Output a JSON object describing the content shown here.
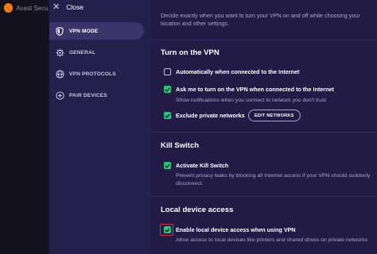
{
  "background_app": {
    "title": "Avast Secu"
  },
  "window": {
    "close_label": "Close"
  },
  "nav": {
    "items": [
      {
        "label": "VPN MODE",
        "icon": "shield-icon",
        "active": true
      },
      {
        "label": "GENERAL",
        "icon": "gear-icon",
        "active": false
      },
      {
        "label": "VPN PROTOCOLS",
        "icon": "globe-icon",
        "active": false
      },
      {
        "label": "PAIR DEVICES",
        "icon": "plus-circle-icon",
        "active": false
      }
    ]
  },
  "content": {
    "intro": "Decide exactly when you want to turn your VPN on and off while choosing your location and other settings.",
    "sections": [
      {
        "title": "Turn on the VPN",
        "options": [
          {
            "label": "Automatically when connected to the Internet",
            "checked": false,
            "description": ""
          },
          {
            "label": "Ask me to turn on the VPN when connected to the Internet",
            "checked": true,
            "description": "Show notifications when you connect to network you don't trust"
          },
          {
            "label": "Exclude private networks",
            "checked": true,
            "description": "",
            "button": "EDIT NETWORKS"
          }
        ]
      },
      {
        "title": "Kill Switch",
        "options": [
          {
            "label": "Activate Kill Switch",
            "checked": true,
            "description": "Prevent privacy leaks by blocking all Internet access if your VPN should suddenly disconnect."
          }
        ]
      },
      {
        "title": "Local device access",
        "options": [
          {
            "label": "Enable local device access when using VPN",
            "checked": true,
            "description": "Allow access to local devices like printers and shared drives on private networks"
          }
        ]
      }
    ]
  },
  "colors": {
    "accent_green": "#20c97a",
    "highlight_red": "#e0283b",
    "panel_bg": "#211b46",
    "nav_bg": "#251f4c"
  }
}
